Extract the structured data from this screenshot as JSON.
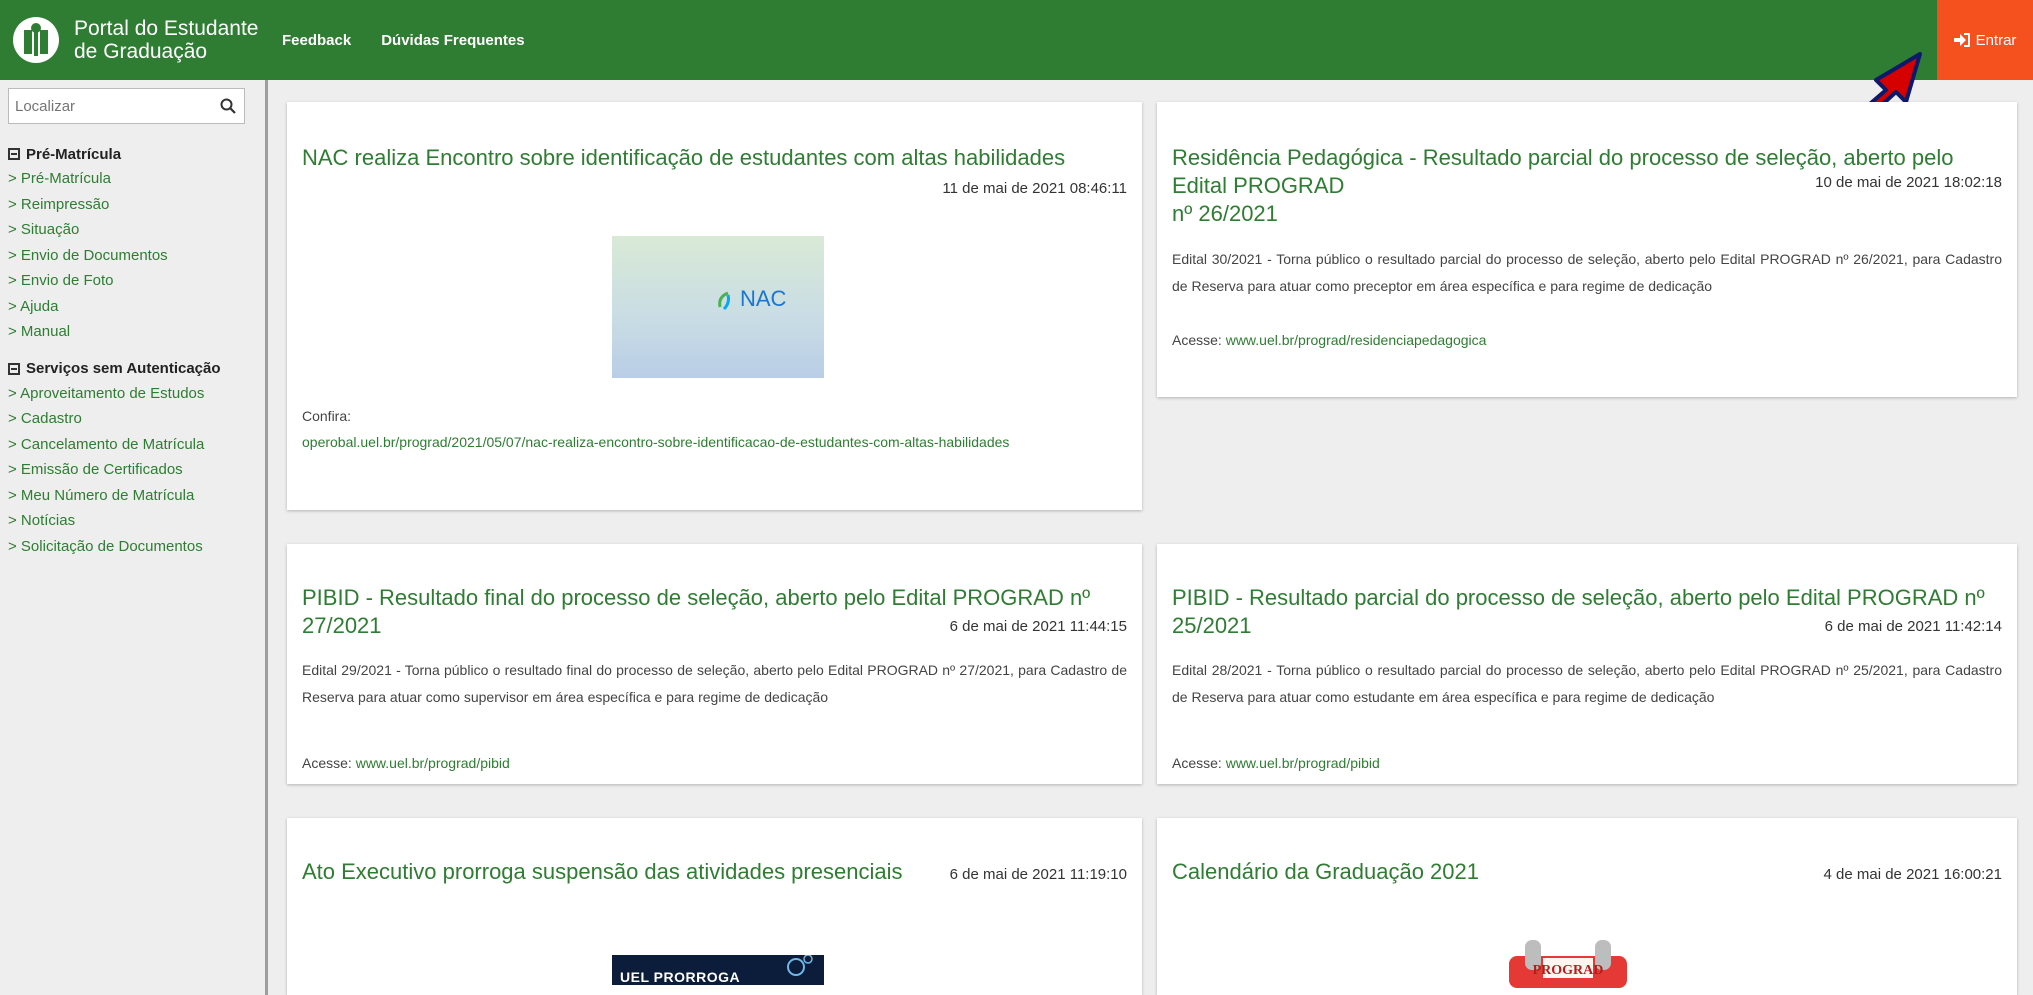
{
  "brand": {
    "title_line1": "Portal do Estudante",
    "title_line2": "de Graduação"
  },
  "nav": {
    "feedback": "Feedback",
    "faq": "Dúvidas Frequentes",
    "login": "Entrar"
  },
  "search": {
    "placeholder": "Localizar",
    "value": ""
  },
  "sidebar": {
    "groups": [
      {
        "title": "Pré-Matrícula",
        "items": [
          "> Pré-Matrícula",
          "> Reimpressão",
          "> Situação",
          "> Envio de Documentos",
          "> Envio de Foto",
          "> Ajuda",
          "> Manual"
        ]
      },
      {
        "title": "Serviços sem Autenticação",
        "items": [
          "> Aproveitamento de Estudos",
          "> Cadastro",
          "> Cancelamento de Matrícula",
          "> Emissão de Certificados",
          "> Meu Número de Matrícula",
          "> Notícias",
          "> Solicitação de Documentos"
        ]
      }
    ]
  },
  "news": [
    {
      "title": "NAC realiza Encontro sobre identificação de estudantes com altas habilidades",
      "date": "11 de mai de 2021 08:46:11",
      "image_text": "NAC",
      "label": "Confira:",
      "link": "operobal.uel.br/prograd/2021/05/07/nac-realiza-encontro-sobre-identificacao-de-estudantes-com-altas-habilidades"
    },
    {
      "title_line1": "Residência Pedagógica - Resultado parcial do processo de seleção, aberto pelo Edital PROGRAD",
      "title_line2": "nº 26/2021",
      "date": "10 de mai de 2021 18:02:18",
      "text": "Edital 30/2021 - Torna público o resultado parcial do processo de seleção, aberto pelo Edital PROGRAD nº 26/2021, para Cadastro de Reserva para atuar como preceptor em área específica e para regime de dedicação",
      "acesse_label": "Acesse: ",
      "acesse_link": "www.uel.br/prograd/residenciapedagogica"
    },
    {
      "title": "PIBID - Resultado final do processo de seleção, aberto pelo Edital PROGRAD nº 27/2021",
      "date": "6 de mai de 2021 11:44:15",
      "text": "Edital 29/2021 - Torna público o resultado final do processo de seleção, aberto pelo Edital PROGRAD nº 27/2021, para Cadastro de Reserva para atuar como supervisor em área específica e para regime de dedicação",
      "acesse_label": "Acesse: ",
      "acesse_link": "www.uel.br/prograd/pibid"
    },
    {
      "title": "PIBID - Resultado parcial do processo de seleção, aberto pelo Edital PROGRAD nº 25/2021",
      "date": "6 de mai de 2021 11:42:14",
      "text": "Edital 28/2021 - Torna público o resultado parcial do processo de seleção, aberto pelo Edital PROGRAD nº 25/2021, para Cadastro de Reserva para atuar como estudante em área específica e para regime de dedicação",
      "acesse_label": "Acesse: ",
      "acesse_link": "www.uel.br/prograd/pibid"
    },
    {
      "title": "Ato Executivo prorroga suspensão das atividades presenciais",
      "date": "6 de mai de 2021 11:19:10",
      "image_text": "UEL PRORROGA"
    },
    {
      "title": "Calendário da Graduação 2021",
      "date": "4 de mai de 2021 16:00:21",
      "image_text": "PROGRAD"
    }
  ],
  "colors": {
    "primary": "#2e7d32",
    "accent": "#f4511e",
    "arrow": "#d50000"
  }
}
